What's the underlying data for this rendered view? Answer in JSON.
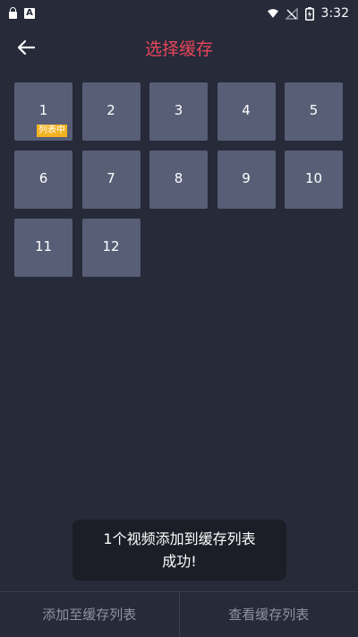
{
  "status_bar": {
    "time": "3:32",
    "notification_app_letter": "A"
  },
  "header": {
    "title": "选择缓存",
    "back_icon": "arrow-left-icon",
    "title_color": "#e8455a"
  },
  "grid": {
    "tiles": [
      {
        "label": "1",
        "badge": "列表中"
      },
      {
        "label": "2"
      },
      {
        "label": "3"
      },
      {
        "label": "4"
      },
      {
        "label": "5"
      },
      {
        "label": "6"
      },
      {
        "label": "7"
      },
      {
        "label": "8"
      },
      {
        "label": "9"
      },
      {
        "label": "10"
      },
      {
        "label": "11"
      },
      {
        "label": "12"
      }
    ],
    "tile_color": "#575e76",
    "badge_color": "#f2b321"
  },
  "toast": {
    "line1": "1个视频添加到缓存列表",
    "line2": "成功!"
  },
  "bottom_bar": {
    "add_label": "添加至缓存列表",
    "view_label": "查看缓存列表"
  }
}
